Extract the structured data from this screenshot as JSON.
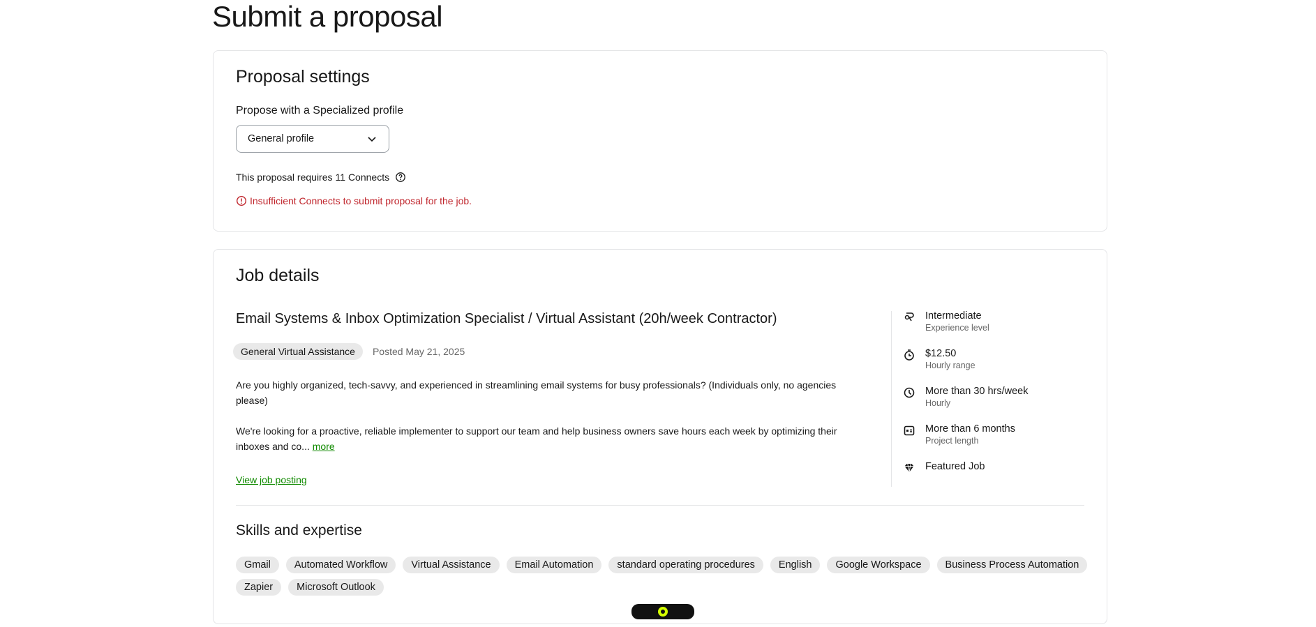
{
  "page": {
    "title": "Submit a proposal"
  },
  "settings": {
    "heading": "Proposal settings",
    "profile_label": "Propose with a Specialized profile",
    "profile_selected": "General profile",
    "connects_text": "This proposal requires",
    "connects_value": "11 Connects",
    "error_text": "Insufficient Connects to submit proposal for the job."
  },
  "job": {
    "heading": "Job details",
    "title": "Email Systems & Inbox Optimization Specialist / Virtual Assistant (20h/week Contractor)",
    "category": "General Virtual Assistance",
    "posted": "Posted May 21, 2025",
    "desc1": "Are you highly organized, tech-savvy, and experienced in streamlining email systems for busy professionals? (Individuals only, no agencies please)",
    "desc2": "We're looking for a proactive, reliable implementer to support our team and help business owners save hours each week by optimizing their inboxes and co...",
    "more_label": "more",
    "view_label": "View job posting",
    "meta": [
      {
        "icon": "experience-level-icon",
        "value": "Intermediate",
        "sub": "Experience level"
      },
      {
        "icon": "hourly-range-icon",
        "value": "$12.50",
        "sub": "Hourly range"
      },
      {
        "icon": "clock-icon",
        "value": "More than 30 hrs/week",
        "sub": "Hourly"
      },
      {
        "icon": "calendar-icon",
        "value": "More than 6 months",
        "sub": "Project length"
      },
      {
        "icon": "diamond-icon",
        "value": "Featured Job",
        "sub": ""
      }
    ]
  },
  "skills": {
    "heading": "Skills and expertise",
    "items": [
      "Gmail",
      "Automated Workflow",
      "Virtual Assistance",
      "Email Automation",
      "standard operating procedures",
      "English",
      "Google Workspace",
      "Business Process Automation",
      "Zapier",
      "Microsoft Outlook"
    ]
  },
  "colors": {
    "error": "#c0262d",
    "link": "#108a00",
    "chip_bg": "#e9e9e9",
    "border": "#e4e5e7",
    "widget_accent": "#d4ff00"
  }
}
